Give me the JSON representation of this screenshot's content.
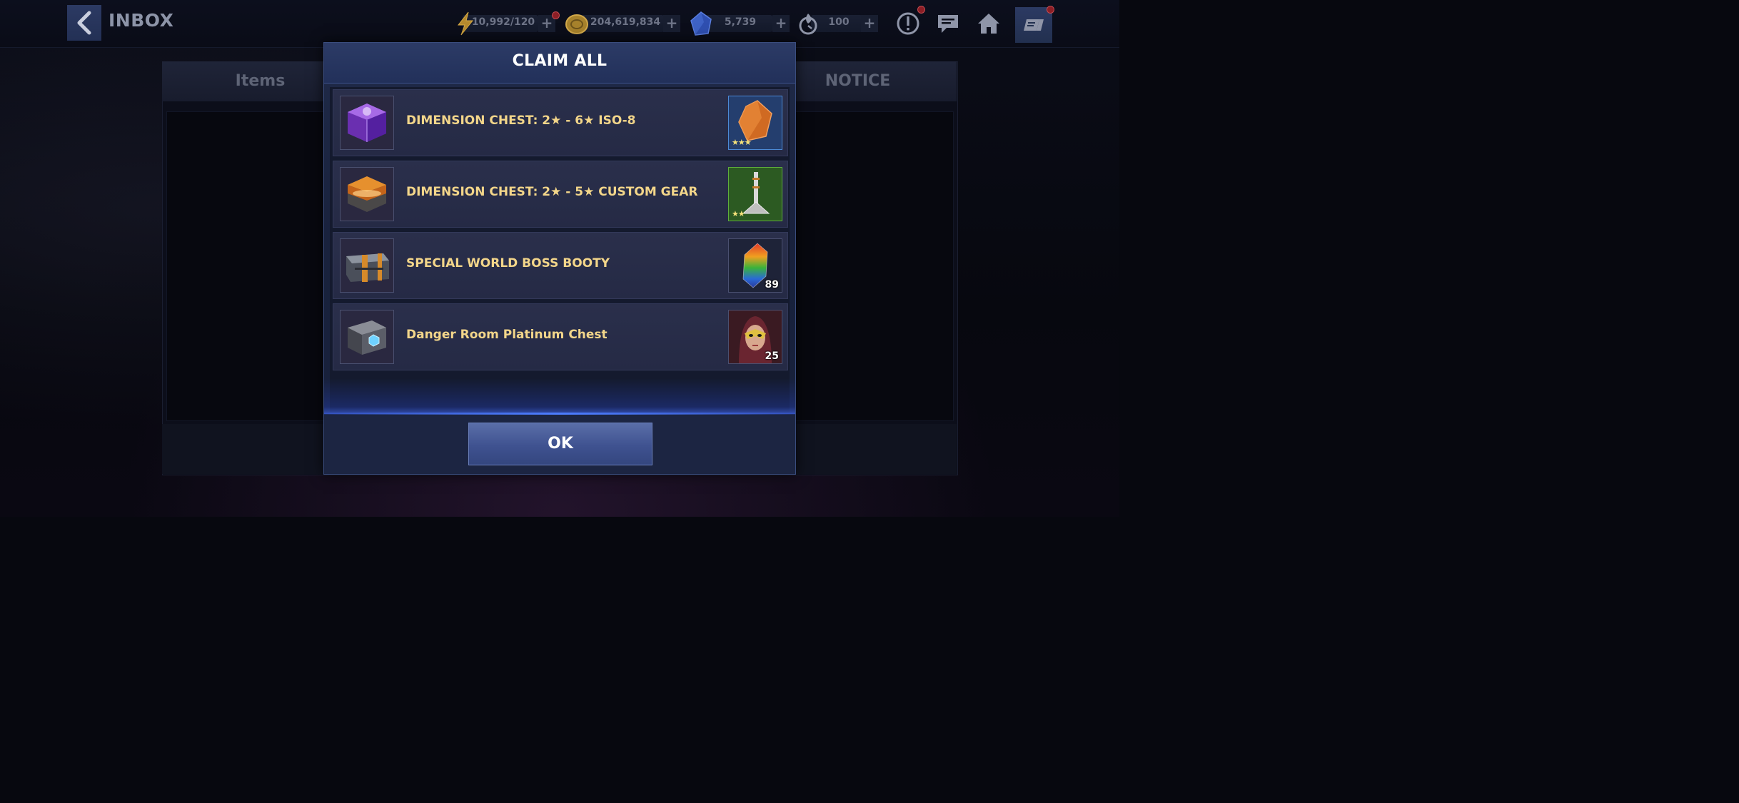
{
  "header": {
    "title": "INBOX",
    "energy": "10,992/120",
    "gold": "204,619,834",
    "power_cores": "5,739",
    "raid_energy": "100"
  },
  "tabs": {
    "items": "Items",
    "notice": "NOTICE"
  },
  "modal": {
    "title": "CLAIM ALL",
    "ok_label": "OK",
    "rows": [
      {
        "label": "DIMENSION CHEST: 2★ - 6★ ISO-8",
        "reward_stars": "★★★",
        "reward_icon": "iso8-crystal-icon"
      },
      {
        "label": "DIMENSION CHEST: 2★ - 5★ CUSTOM GEAR",
        "reward_stars": "★★",
        "reward_icon": "custom-gear-icon"
      },
      {
        "label": "SPECIAL WORLD BOSS BOOTY",
        "reward_count": "89",
        "reward_icon": "rainbow-crystal-icon"
      },
      {
        "label": "Danger Room Platinum Chest",
        "reward_count": "25",
        "reward_icon": "character-shard-icon"
      }
    ]
  },
  "colors": {
    "accent": "#4d7dff",
    "label_gold": "#f3d68a",
    "button_blue": "#3f5290"
  }
}
